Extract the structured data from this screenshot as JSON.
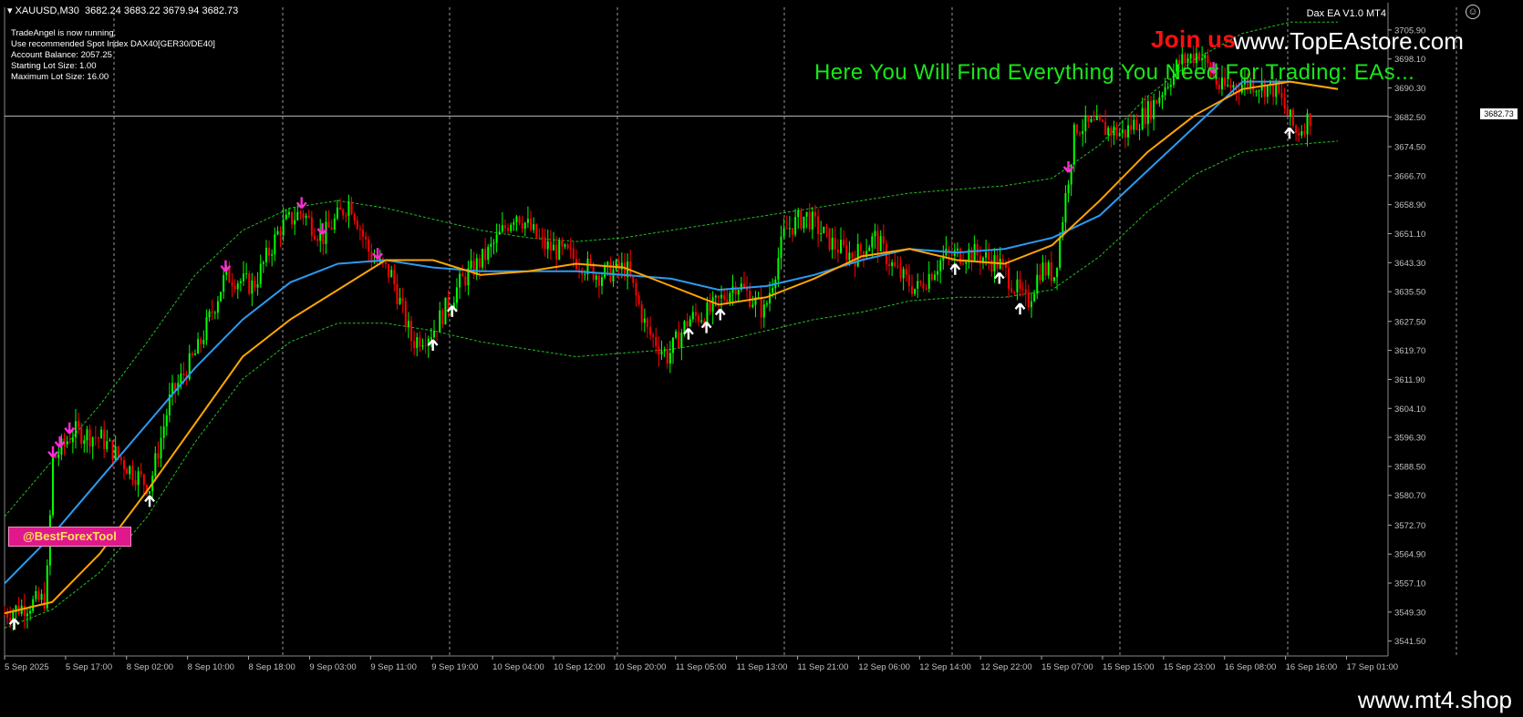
{
  "window": {
    "symbol": "XAUUSD,M30",
    "ohlc": "3682.24 3683.22 3679.94 3682.73",
    "ea_name": "Dax EA V1.0 MT4"
  },
  "info_lines": [
    "TradeAngel is now running.",
    "Use recommended Spot Index DAX40[GER30/DE40]",
    "Account Balance: 2057.25",
    "Starting Lot Size: 1.00",
    "Maximum Lot Size: 16.00"
  ],
  "overlay": {
    "join_text": "Join us",
    "site_text": "www.TopEAstore.com",
    "promo_text": "Here You Will Find Everything You Need For Trading: EAs...",
    "badge_text": "@BestForexTool",
    "current_price": "3682.73"
  },
  "footer": {
    "site": "www.mt4.shop"
  },
  "chart_data": {
    "type": "line",
    "title": "",
    "price_levels": [
      "3705.90",
      "3698.10",
      "3690.30",
      "3682.50",
      "3674.50",
      "3666.70",
      "3658.90",
      "3651.10",
      "3643.30",
      "3635.50",
      "3627.50",
      "3619.70",
      "3611.90",
      "3604.10",
      "3596.30",
      "3588.50",
      "3580.70",
      "3572.70",
      "3564.90",
      "3557.10",
      "3549.30",
      "3541.50"
    ],
    "time_labels": [
      "5 Sep 2025",
      "5 Sep 17:00",
      "8 Sep 02:00",
      "8 Sep 10:00",
      "8 Sep 18:00",
      "9 Sep 03:00",
      "9 Sep 11:00",
      "9 Sep 19:00",
      "10 Sep 04:00",
      "10 Sep 12:00",
      "10 Sep 20:00",
      "11 Sep 05:00",
      "11 Sep 13:00",
      "11 Sep 21:00",
      "12 Sep 06:00",
      "12 Sep 14:00",
      "12 Sep 22:00",
      "15 Sep 07:00",
      "15 Sep 15:00",
      "15 Sep 23:00",
      "16 Sep 08:00",
      "16 Sep 16:00",
      "17 Sep 01:00"
    ],
    "ylim": [
      3541.5,
      3705.9
    ],
    "grid": "vertical dashed",
    "price_path": [
      {
        "t": 0,
        "p": 3549
      },
      {
        "t": 0.03,
        "p": 3553
      },
      {
        "t": 0.035,
        "p": 3590
      },
      {
        "t": 0.05,
        "p": 3598
      },
      {
        "t": 0.07,
        "p": 3596
      },
      {
        "t": 0.09,
        "p": 3588
      },
      {
        "t": 0.105,
        "p": 3583
      },
      {
        "t": 0.12,
        "p": 3607
      },
      {
        "t": 0.14,
        "p": 3620
      },
      {
        "t": 0.16,
        "p": 3640
      },
      {
        "t": 0.18,
        "p": 3637
      },
      {
        "t": 0.2,
        "p": 3653
      },
      {
        "t": 0.215,
        "p": 3657
      },
      {
        "t": 0.23,
        "p": 3650
      },
      {
        "t": 0.25,
        "p": 3660
      },
      {
        "t": 0.265,
        "p": 3645
      },
      {
        "t": 0.28,
        "p": 3640
      },
      {
        "t": 0.295,
        "p": 3622
      },
      {
        "t": 0.31,
        "p": 3625
      },
      {
        "t": 0.33,
        "p": 3638
      },
      {
        "t": 0.35,
        "p": 3646
      },
      {
        "t": 0.37,
        "p": 3657
      },
      {
        "t": 0.39,
        "p": 3648
      },
      {
        "t": 0.41,
        "p": 3645
      },
      {
        "t": 0.43,
        "p": 3640
      },
      {
        "t": 0.45,
        "p": 3642
      },
      {
        "t": 0.465,
        "p": 3625
      },
      {
        "t": 0.48,
        "p": 3618
      },
      {
        "t": 0.495,
        "p": 3628
      },
      {
        "t": 0.51,
        "p": 3630
      },
      {
        "t": 0.53,
        "p": 3638
      },
      {
        "t": 0.55,
        "p": 3630
      },
      {
        "t": 0.565,
        "p": 3652
      },
      {
        "t": 0.58,
        "p": 3656
      },
      {
        "t": 0.6,
        "p": 3648
      },
      {
        "t": 0.615,
        "p": 3645
      },
      {
        "t": 0.63,
        "p": 3650
      },
      {
        "t": 0.645,
        "p": 3641
      },
      {
        "t": 0.66,
        "p": 3636
      },
      {
        "t": 0.68,
        "p": 3645
      },
      {
        "t": 0.7,
        "p": 3646
      },
      {
        "t": 0.72,
        "p": 3643
      },
      {
        "t": 0.74,
        "p": 3632
      },
      {
        "t": 0.75,
        "p": 3642
      },
      {
        "t": 0.76,
        "p": 3640
      },
      {
        "t": 0.775,
        "p": 3680
      },
      {
        "t": 0.79,
        "p": 3680
      },
      {
        "t": 0.81,
        "p": 3678
      },
      {
        "t": 0.83,
        "p": 3685
      },
      {
        "t": 0.85,
        "p": 3697
      },
      {
        "t": 0.865,
        "p": 3700
      },
      {
        "t": 0.88,
        "p": 3690
      },
      {
        "t": 0.9,
        "p": 3692
      },
      {
        "t": 0.92,
        "p": 3690
      },
      {
        "t": 0.935,
        "p": 3678
      },
      {
        "t": 0.945,
        "p": 3682.73
      }
    ],
    "series": [
      {
        "color": "#2b9bf0",
        "values": [
          3557,
          3570,
          3585,
          3600,
          3615,
          3628,
          3638,
          3643,
          3644,
          3642,
          3641,
          3641,
          3641,
          3640,
          3639,
          3636,
          3637,
          3640,
          3644,
          3647,
          3646,
          3647,
          3650,
          3656,
          3668,
          3680,
          3692,
          3692,
          3690
        ]
      },
      {
        "color": "#ffa500",
        "values": [
          3549,
          3552,
          3565,
          3582,
          3600,
          3618,
          3628,
          3636,
          3644,
          3644,
          3640,
          3641,
          3643,
          3642,
          3637,
          3632,
          3634,
          3639,
          3645,
          3647,
          3644,
          3643,
          3648,
          3660,
          3673,
          3683,
          3690,
          3692,
          3690
        ]
      },
      {
        "color": "#20c020",
        "values": [
          3575,
          3590,
          3605,
          3622,
          3640,
          3652,
          3658,
          3660,
          3658,
          3655,
          3652,
          3650,
          3649,
          3650,
          3652,
          3654,
          3656,
          3658,
          3660,
          3662,
          3663,
          3664,
          3666,
          3675,
          3688,
          3698,
          3705,
          3708,
          3708
        ]
      },
      {
        "color": "#20c020",
        "values": [
          3545,
          3550,
          3560,
          3575,
          3595,
          3612,
          3622,
          3627,
          3627,
          3625,
          3622,
          3620,
          3618,
          3619,
          3620,
          3622,
          3625,
          3628,
          3630,
          3633,
          3634,
          3634,
          3636,
          3645,
          3657,
          3667,
          3673,
          3675,
          3676
        ]
      }
    ],
    "arrows_down_magenta": [
      0.035,
      0.04,
      0.047,
      0.16,
      0.215,
      0.23,
      0.27,
      0.77,
      0.875
    ],
    "arrows_up_white": [
      0.007,
      0.105,
      0.31,
      0.324,
      0.495,
      0.508,
      0.518,
      0.688,
      0.72,
      0.735,
      0.93
    ]
  },
  "colors": {
    "bull": "#00ff00",
    "bear": "#ff0000",
    "axis": "#c0c0c0",
    "grid": "#c8c8c8"
  }
}
